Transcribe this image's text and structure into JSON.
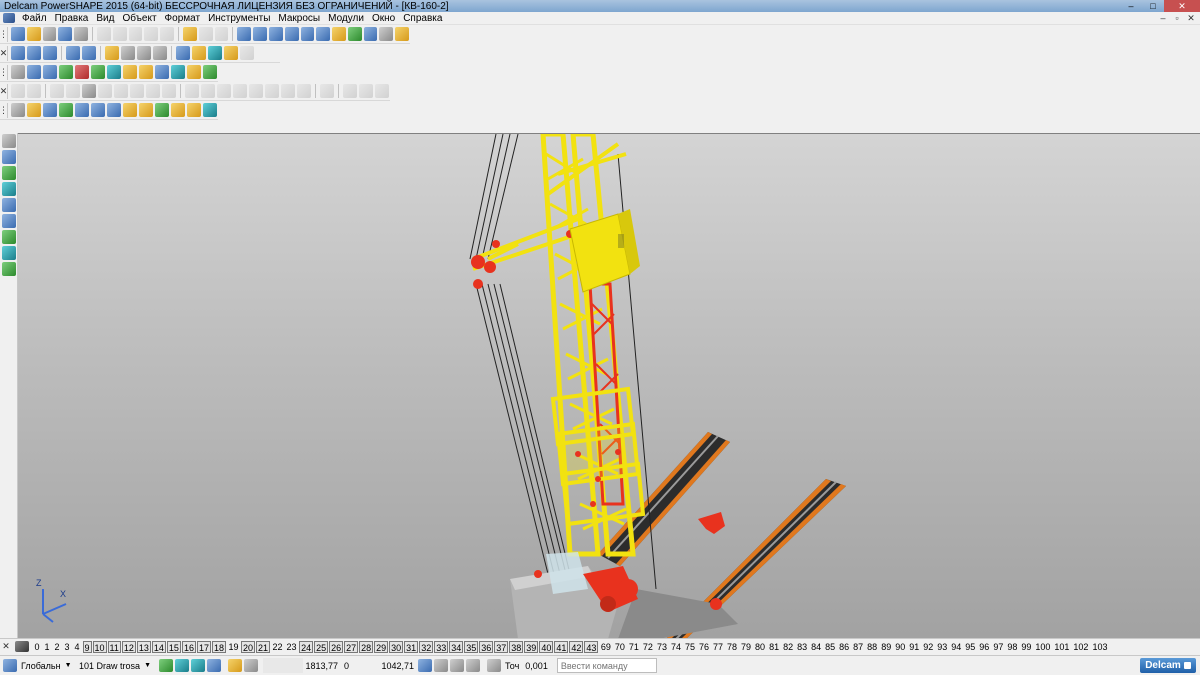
{
  "window": {
    "title": "Delcam PowerSHAPE 2015 (64-bit) БЕССРОЧНАЯ ЛИЦЕНЗИЯ БЕЗ ОГРАНИЧЕНИЙ - [КВ-160-2]",
    "minimize": "–",
    "maximize": "□",
    "close": "✕"
  },
  "menu": {
    "items": [
      "Файл",
      "Правка",
      "Вид",
      "Объект",
      "Формат",
      "Инструменты",
      "Макросы",
      "Модули",
      "Окно",
      "Справка"
    ],
    "mdi_minimize": "–",
    "mdi_restore": "▫",
    "mdi_close": "✕"
  },
  "levels": {
    "numbers": [
      "0",
      "1",
      "2",
      "3",
      "4",
      "9",
      "10",
      "11",
      "12",
      "13",
      "14",
      "15",
      "16",
      "17",
      "18",
      "19",
      "20",
      "21",
      "22",
      "23",
      "24",
      "25",
      "26",
      "27",
      "28",
      "29",
      "30",
      "31",
      "32",
      "33",
      "34",
      "35",
      "36",
      "37",
      "38",
      "39",
      "40",
      "41",
      "42",
      "43",
      "69",
      "70",
      "71",
      "72",
      "73",
      "74",
      "75",
      "76",
      "77",
      "78",
      "79",
      "80",
      "81",
      "82",
      "83",
      "84",
      "85",
      "86",
      "87",
      "88",
      "89",
      "90",
      "91",
      "92",
      "93",
      "94",
      "95",
      "96",
      "97",
      "98",
      "99",
      "100",
      "101",
      "102",
      "103"
    ],
    "boxed": [
      "9",
      "10",
      "11",
      "12",
      "13",
      "14",
      "15",
      "16",
      "17",
      "18",
      "20",
      "21",
      "24",
      "25",
      "26",
      "27",
      "28",
      "29",
      "30",
      "31",
      "32",
      "33",
      "34",
      "35",
      "36",
      "37",
      "38",
      "39",
      "40",
      "41",
      "42",
      "43"
    ]
  },
  "status": {
    "workplane": "Глобальн",
    "level_number": "101",
    "level_name": "Draw trosa",
    "coord_x": "1813,77",
    "coord_y": "0",
    "coord_z": "1042,71",
    "tolerance_label": "Точ",
    "tolerance_value": "0,001",
    "command_placeholder": "Ввести команду"
  },
  "brand": "Delcam",
  "axis": {
    "x": "X",
    "z": "Z"
  },
  "colors": {
    "crane_yellow": "#f2e210",
    "crane_red": "#e8321e",
    "rail_orange": "#e0781e",
    "cabin_grey": "#c8c8c8"
  }
}
